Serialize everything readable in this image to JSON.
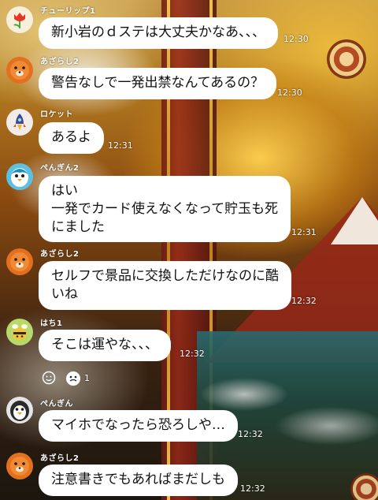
{
  "messages": [
    {
      "sender": "チューリップ1",
      "avatar_icon": "tulip-icon",
      "text": "新小岩のｄステは大丈夫かなあ、、、",
      "time": "12:30"
    },
    {
      "sender": "あざらし2",
      "avatar_icon": "seal-icon",
      "text": "警告なしで一発出禁なんてあるの？",
      "time": "12:30"
    },
    {
      "sender": "ロケット",
      "avatar_icon": "rocket-icon",
      "text": "あるよ",
      "time": "12:31"
    },
    {
      "sender": "ぺんぎん2",
      "avatar_icon": "penguin-icon",
      "text": "はい\n一発でカード使えなくなって貯玉も死\nにました",
      "time": "12:31"
    },
    {
      "sender": "あざらし2",
      "avatar_icon": "seal-icon",
      "text": "セルフで景品に交換しただけなのに酷\nいね",
      "time": "12:32"
    },
    {
      "sender": "はち1",
      "avatar_icon": "bee-icon",
      "text": "そこは運やな、、、",
      "time": "12:32"
    },
    {
      "sender": "ぺんぎん",
      "avatar_icon": "penguin-icon",
      "text": "マイホでなったら恐ろしや…",
      "time": "12:32"
    },
    {
      "sender": "あざらし2",
      "avatar_icon": "seal-icon",
      "text": "注意書きでもあればまだしも",
      "time": "12:32"
    }
  ],
  "reactions": {
    "icons": [
      "smile-icon",
      "sticker-face-icon"
    ],
    "count": "1"
  },
  "colors": {
    "bubble": "#ffffff",
    "text": "#111111",
    "meta_text": "#ffffff"
  }
}
